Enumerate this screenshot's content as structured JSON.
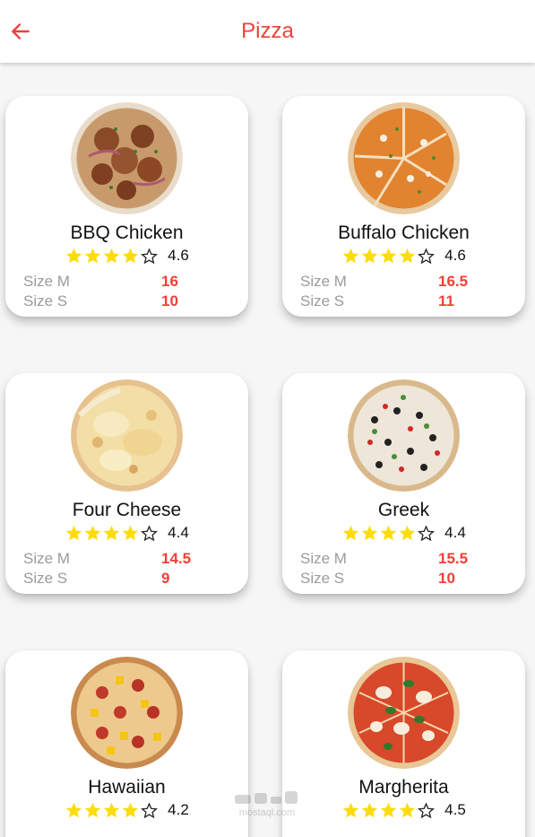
{
  "appbar": {
    "title": "Pizza"
  },
  "colors": {
    "accent": "#ef4138",
    "star": "#fddc0e",
    "muted": "#9b9b9b"
  },
  "watermark": {
    "text": "mostaql.com"
  },
  "pizzas": [
    {
      "name": "BBQ Chicken",
      "stars": 4,
      "rating": "4.6",
      "size_m_label": "Size M",
      "size_m_price": "16",
      "size_s_label": "Size S",
      "size_s_price": "10"
    },
    {
      "name": "Buffalo Chicken",
      "stars": 4,
      "rating": "4.6",
      "size_m_label": "Size M",
      "size_m_price": "16.5",
      "size_s_label": "Size S",
      "size_s_price": "11"
    },
    {
      "name": "Four Cheese",
      "stars": 4,
      "rating": "4.4",
      "size_m_label": "Size M",
      "size_m_price": "14.5",
      "size_s_label": "Size S",
      "size_s_price": "9"
    },
    {
      "name": "Greek",
      "stars": 4,
      "rating": "4.4",
      "size_m_label": "Size M",
      "size_m_price": "15.5",
      "size_s_label": "Size S",
      "size_s_price": "10"
    },
    {
      "name": "Hawaiian",
      "stars": 4,
      "rating": "4.2"
    },
    {
      "name": "Margherita",
      "stars": 4,
      "rating": "4.5"
    }
  ]
}
